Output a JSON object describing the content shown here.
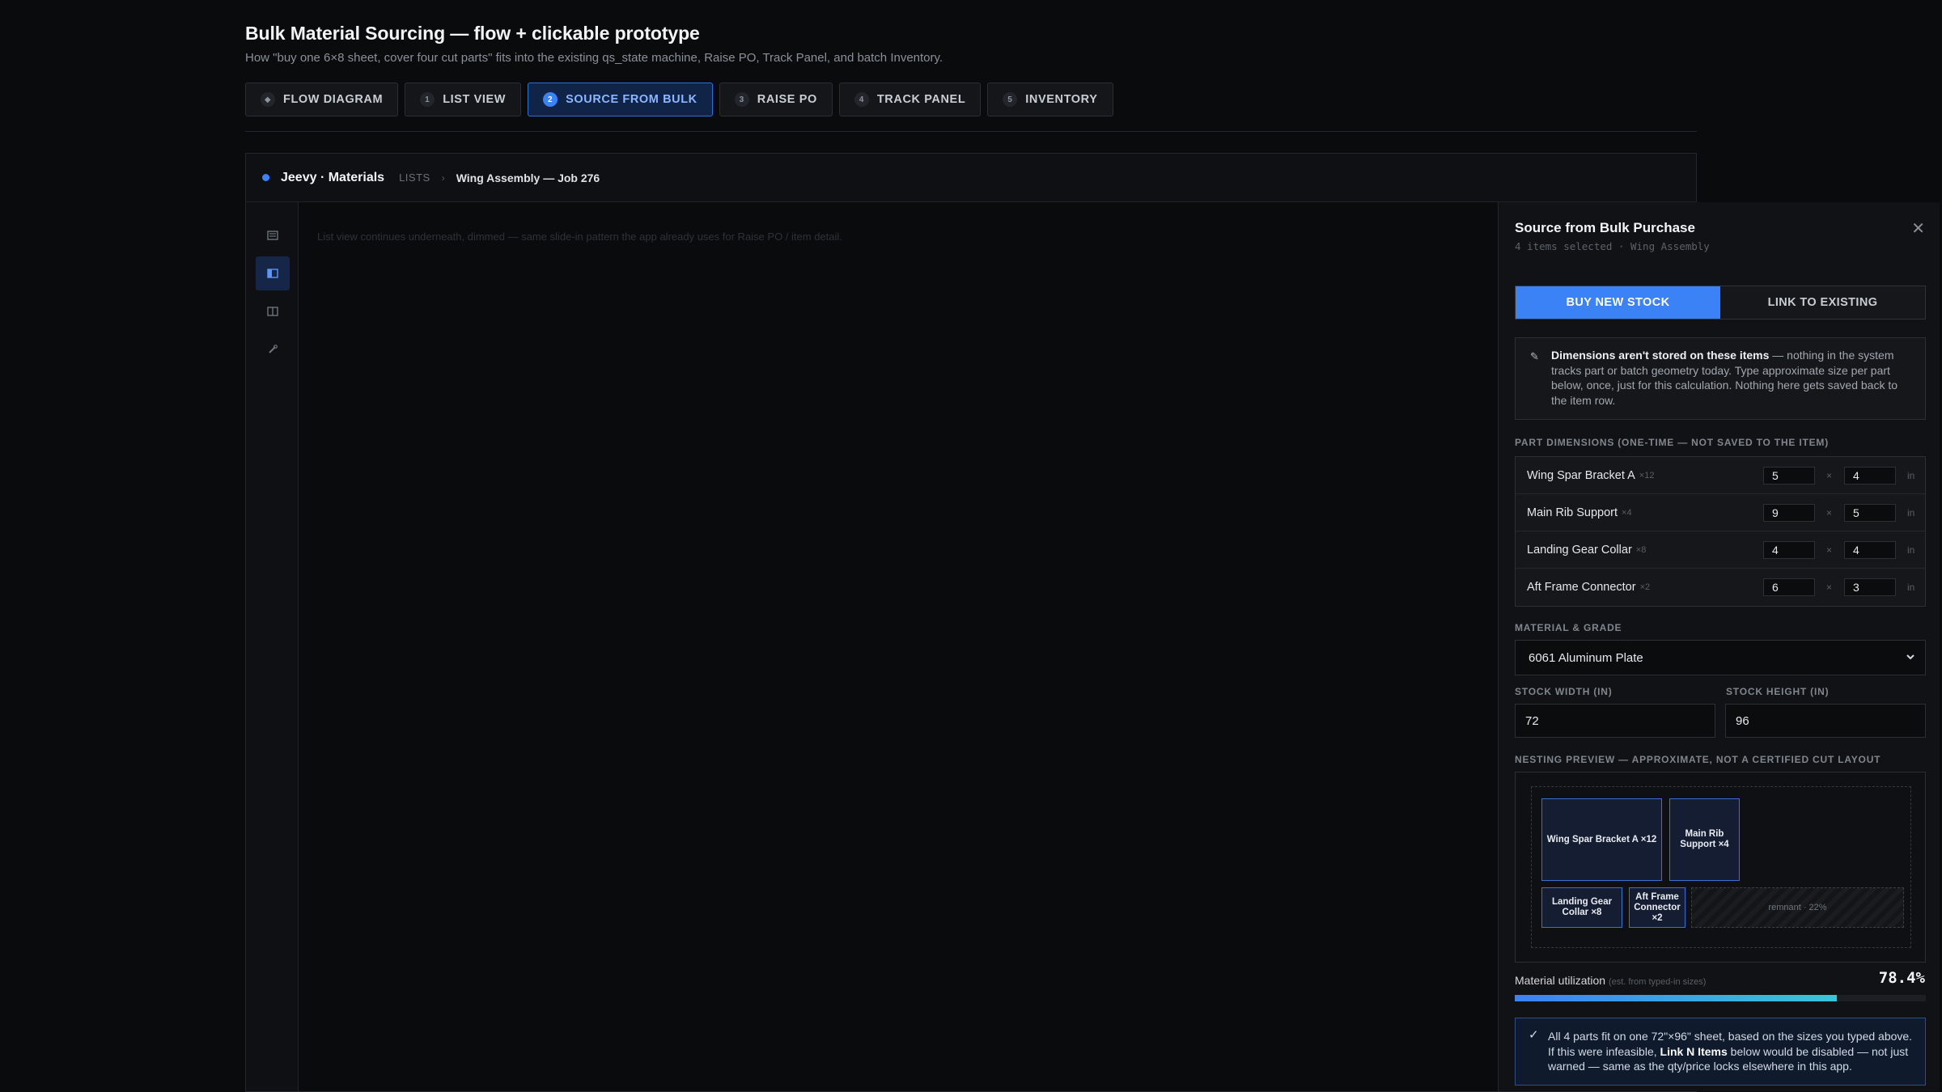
{
  "header": {
    "title": "Bulk Material Sourcing — flow + clickable prototype",
    "subtitle": "How \"buy one 6×8 sheet, cover four cut parts\" fits into the existing qs_state machine, Raise PO, Track Panel, and batch Inventory."
  },
  "tabs": [
    {
      "num": "◆",
      "label": "FLOW DIAGRAM"
    },
    {
      "num": "1",
      "label": "LIST VIEW"
    },
    {
      "num": "2",
      "label": "SOURCE FROM BULK",
      "active": true
    },
    {
      "num": "3",
      "label": "RAISE PO"
    },
    {
      "num": "4",
      "label": "TRACK PANEL"
    },
    {
      "num": "5",
      "label": "INVENTORY"
    }
  ],
  "app": {
    "brand": "Jeevy · Materials",
    "crumb_lists": "LISTS",
    "crumb_sep": "›",
    "crumb_job": "Wing Assembly — Job 276",
    "rail_icons": [
      "list-icon",
      "panel-icon",
      "columns-icon",
      "wrench-icon"
    ],
    "list_note": "List view continues underneath, dimmed — same slide-in pattern the app already uses for Raise PO / item detail."
  },
  "panel": {
    "title": "Source from Bulk Purchase",
    "meta": "4 items selected · Wing Assembly",
    "close": "✕",
    "seg": {
      "buy": "BUY NEW STOCK",
      "link": "LINK TO EXISTING"
    },
    "note": {
      "icon": "✎",
      "bold": "Dimensions aren't stored on these items",
      "text": " — nothing in the system tracks part or batch geometry today. Type approximate size per part below, once, just for this calculation. Nothing here gets saved back to the item row."
    },
    "dims_label": "PART DIMENSIONS (ONE-TIME — NOT SAVED TO THE ITEM)",
    "dims": [
      {
        "name": "Wing Spar Bracket A",
        "qty": "×12",
        "w": "5",
        "h": "4"
      },
      {
        "name": "Main Rib Support",
        "qty": "×4",
        "w": "9",
        "h": "5"
      },
      {
        "name": "Landing Gear Collar",
        "qty": "×8",
        "w": "4",
        "h": "4"
      },
      {
        "name": "Aft Frame Connector",
        "qty": "×2",
        "w": "6",
        "h": "3"
      }
    ],
    "dim_x": "×",
    "dim_unit": "in",
    "material_label": "MATERIAL & GRADE",
    "material_value": "6061 Aluminum Plate",
    "stock_width_label": "STOCK WIDTH (IN)",
    "stock_width": "72",
    "stock_height_label": "STOCK HEIGHT (IN)",
    "stock_height": "96",
    "nest_label": "NESTING PREVIEW — APPROXIMATE, NOT A CERTIFIED CUT LAYOUT",
    "nest_parts": [
      "Wing Spar Bracket A ×12",
      "Main Rib Support ×4",
      "Landing Gear Collar ×8",
      "Aft Frame Connector ×2"
    ],
    "remnant": "remnant · 22%",
    "util_label": "Material utilization",
    "util_sub": "(est. from typed-in sizes)",
    "util_value": "78.4%",
    "util_fraction": 0.784,
    "ok": {
      "icon": "✓",
      "text1": "All 4 parts fit on one 72\"×96\" sheet, based on the sizes you typed above. If this were infeasible, ",
      "bold": "Link N Items",
      "text2": " below would be disabled — not just warned — same as the qty/price locks elsewhere in this app."
    }
  },
  "colors": {
    "accent": "#3b82f6",
    "accent_teal": "#38c6d6",
    "bg": "#0a0b0d"
  }
}
